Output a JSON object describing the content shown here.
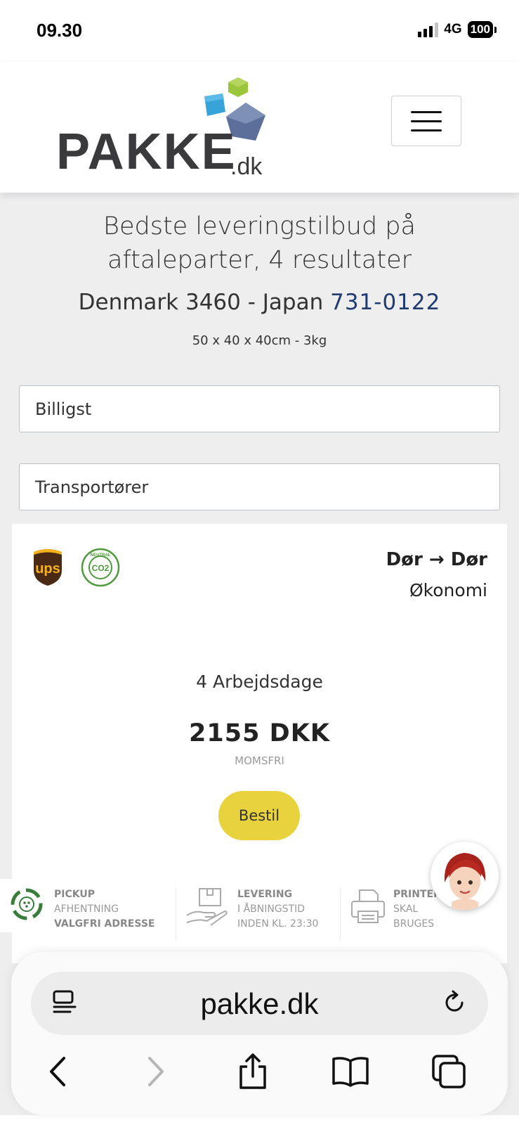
{
  "status_bar": {
    "time": "09.30",
    "network": "4G",
    "battery": "100"
  },
  "header": {
    "logo_text": "PAKKE",
    "logo_tld": ".dk",
    "colors": {
      "cube_green": "#9bc53d",
      "cube_blue": "#36a3d9",
      "cube_slate": "#5b6f9a"
    }
  },
  "intro": {
    "headline": "Bedste leveringstilbud på aftaleparter, 4 resultater",
    "route_prefix": "Denmark 3460 - Japan",
    "route_postcode": "731-0122",
    "dimensions": "50 x 40 x 40cm - 3kg"
  },
  "filters": {
    "sort_value": "Billigst",
    "carrier_value": "Transportører"
  },
  "result": {
    "route_type": "Dør → Dør",
    "service_level": "Økonomi",
    "delivery_time": "4 Arbejdsdage",
    "price": "2155 DKK",
    "vat_note": "MOMSFRI",
    "order_label": "Bestil",
    "ups_text": "ups",
    "co2_text": "CO2",
    "co2_ring_text": "NEUTRAL",
    "colors": {
      "order_button": "#e8d33e",
      "ups_brown": "#4a2a14",
      "ups_gold": "#f5b21c",
      "co2_green": "#4d9a3c"
    }
  },
  "features": [
    {
      "title": "PICKUP",
      "line1": "AFHENTNING",
      "line2": "VALGFRI ADRESSE",
      "icon": "pickup-cycle-icon"
    },
    {
      "title": "LEVERING",
      "line1": "I ÅBNINGSTID",
      "line2": "INDEN KL. 23:30",
      "icon": "hand-package-icon"
    },
    {
      "title": "PRINTER",
      "line1": "SKAL",
      "line2": "BRUGES",
      "icon": "printer-icon"
    }
  ],
  "browser": {
    "url": "pakke.dk"
  }
}
